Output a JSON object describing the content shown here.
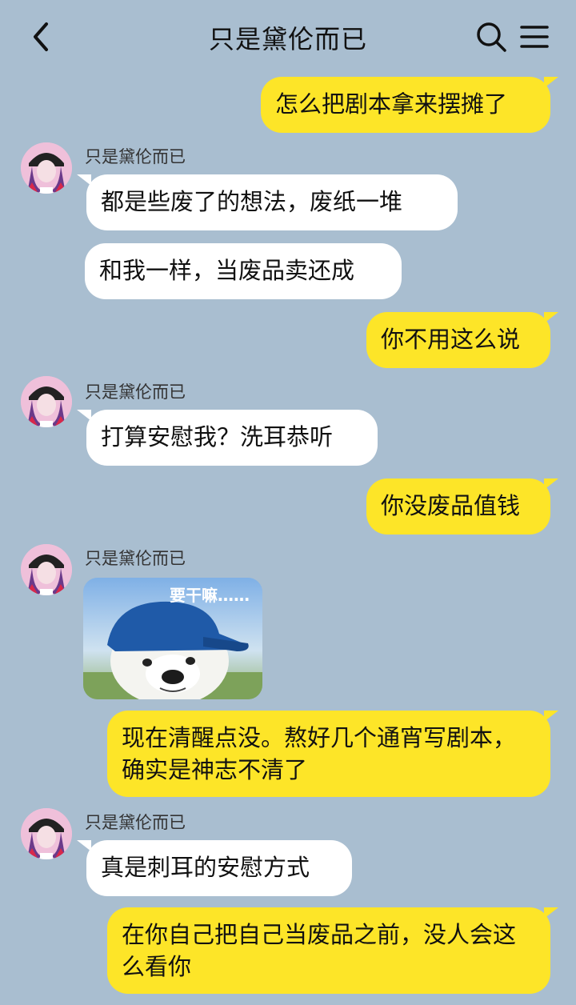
{
  "header": {
    "title": "只是黛伦而已"
  },
  "contact": {
    "name": "只是黛伦而已"
  },
  "messages": {
    "m1": "怎么把剧本拿来摆摊了",
    "m2": "都是些废了的想法，废纸一堆",
    "m3": "和我一样，当废品卖还成",
    "m4": "你不用这么说",
    "m5": "打算安慰我？洗耳恭听",
    "m6": "你没废品值钱",
    "m7_sticker_text": "要干嘛……",
    "m8": "现在清醒点没。熬好几个通宵写剧本，确实是神志不清了",
    "m9": "真是刺耳的安慰方式",
    "m10": "在你自己把自己当废品之前，没人会这么看你"
  },
  "colors": {
    "background": "#a9bed0",
    "outgoing_bubble": "#fde528",
    "incoming_bubble": "#ffffff"
  },
  "icons": {
    "back": "chevron-left-icon",
    "search": "search-icon",
    "menu": "menu-icon"
  }
}
